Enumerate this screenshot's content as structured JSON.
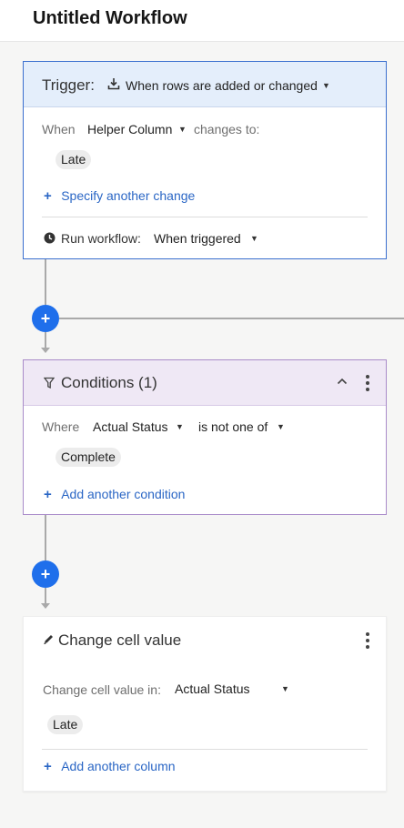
{
  "page": {
    "title": "Untitled Workflow"
  },
  "trigger": {
    "label": "Trigger:",
    "icon": "download-tray-icon",
    "type_label": "When rows are added or changed",
    "when_label": "When",
    "column": "Helper Column",
    "changes_to_label": "changes to:",
    "value": "Late",
    "add_change_label": "Specify another change",
    "run_label": "Run workflow:",
    "run_value": "When triggered",
    "accent_color": "#3b6fcf"
  },
  "conditions": {
    "title": "Conditions (1)",
    "where_label": "Where",
    "column": "Actual Status",
    "operator": "is not one of",
    "value": "Complete",
    "add_label": "Add another condition",
    "accent_color": "#a98bc9"
  },
  "action": {
    "title": "Change cell value",
    "field_label": "Change cell value in:",
    "column": "Actual Status",
    "value": "Late",
    "add_label": "Add another column"
  },
  "controls": {
    "add_block_symbol": "+",
    "add_link_symbol": "+",
    "caret_symbol": "▼",
    "collapse_symbol": "⌃"
  }
}
